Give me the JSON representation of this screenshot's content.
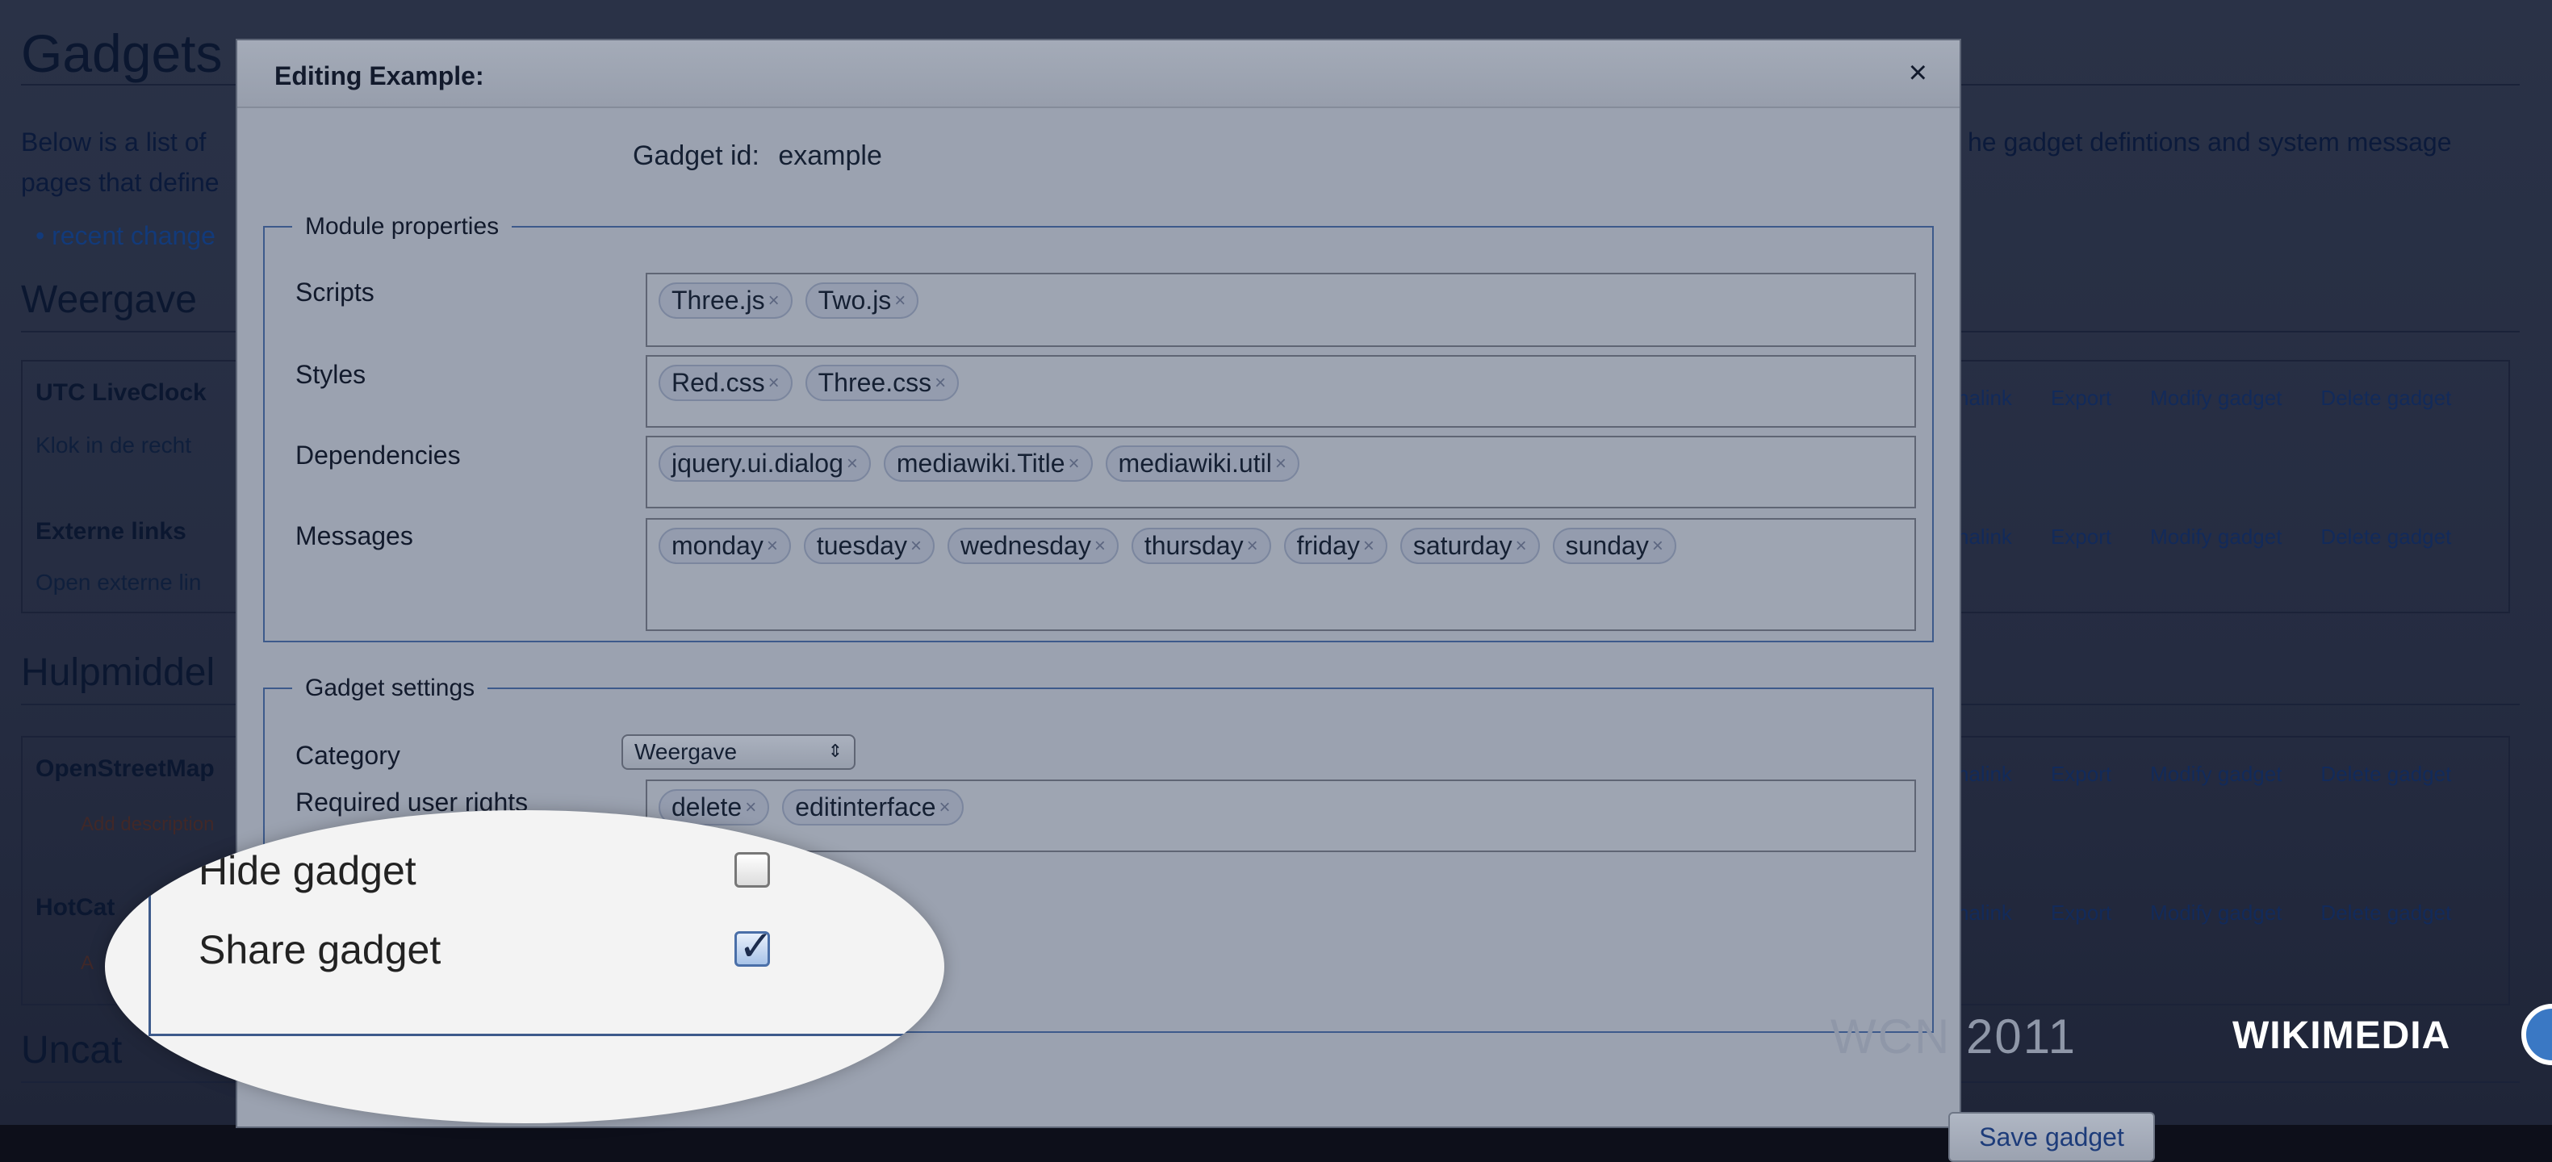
{
  "background": {
    "title": "Gadgets",
    "intro_left": "Below is a list of",
    "intro_left_line2": "pages that define",
    "intro_right": "he gadget defintions and system message",
    "recent_link": "recent change",
    "sections": [
      {
        "heading": "Weergave",
        "gadgets": [
          {
            "name": "UTC LiveClock",
            "desc": "Klok in de recht"
          },
          {
            "name": "Externe links",
            "desc": "Open externe lin"
          }
        ]
      },
      {
        "heading": "Hulpmiddel",
        "gadgets": [
          {
            "name": "OpenStreetMap",
            "desc": "Add description"
          },
          {
            "name": "HotCat",
            "desc": "A"
          }
        ]
      },
      {
        "heading": "Uncat",
        "gadgets": []
      }
    ],
    "gadget_links": [
      "nalink",
      "Export",
      "Modify gadget",
      "Delete gadget"
    ]
  },
  "dialog": {
    "title": "Editing Example:",
    "close_icon": "×",
    "gadget_id_label": "Gadget id:",
    "gadget_id_value": "example",
    "module_legend": "Module properties",
    "scripts_label": "Scripts",
    "scripts": [
      "Three.js",
      "Two.js"
    ],
    "styles_label": "Styles",
    "styles": [
      "Red.css",
      "Three.css"
    ],
    "dependencies_label": "Dependencies",
    "dependencies": [
      "jquery.ui.dialog",
      "mediawiki.Title",
      "mediawiki.util"
    ],
    "messages_label": "Messages",
    "messages": [
      "monday",
      "tuesday",
      "wednesday",
      "thursday",
      "friday",
      "saturday",
      "sunday"
    ],
    "settings_legend": "Gadget settings",
    "category_label": "Category",
    "category_value": "Weergave",
    "rights_label": "Required user rights",
    "rights": [
      "delete",
      "editinterface"
    ],
    "hide_label": "Hide gadget",
    "hide_checked": false,
    "share_label": "Share gadget",
    "share_checked": true,
    "save_label": "Save gadget"
  },
  "branding": {
    "event": "WCN 2011",
    "org": "WIKIMEDIA"
  }
}
